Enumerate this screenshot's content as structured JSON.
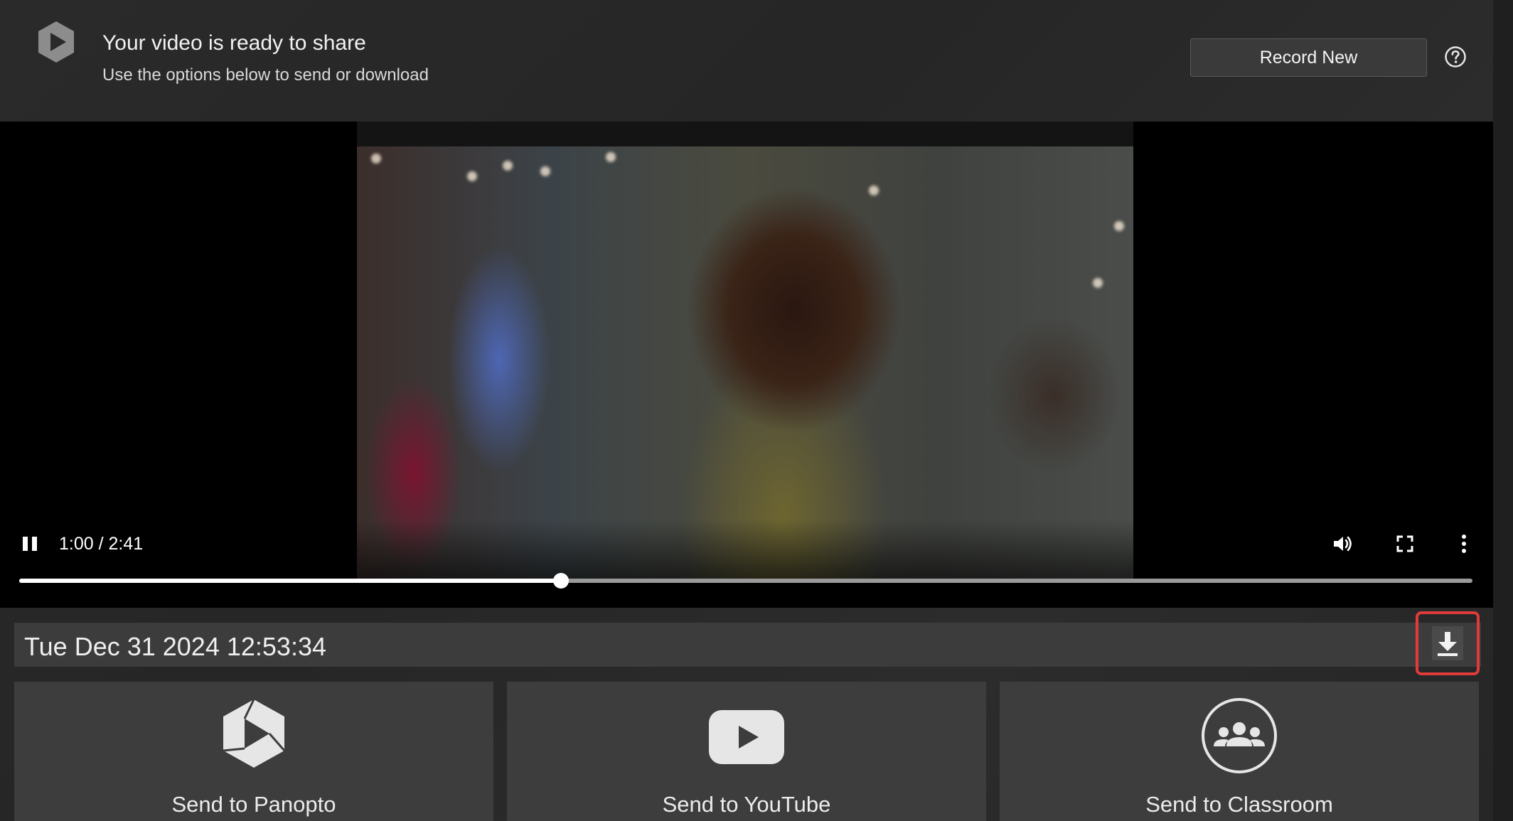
{
  "header": {
    "title": "Your video is ready to share",
    "subtitle": "Use the options below to send or download",
    "record_new_label": "Record New",
    "logo_icon": "panopto-logo-icon",
    "help_icon": "help-circle-icon"
  },
  "player": {
    "time_display": "1:00 / 2:41",
    "current_seconds": 60,
    "duration_seconds": 161,
    "pause_icon": "pause-icon",
    "volume_icon": "volume-icon",
    "fullscreen_icon": "fullscreen-icon",
    "more_icon": "more-vertical-icon"
  },
  "recording": {
    "name": "Tue Dec 31 2024 12:53:34",
    "download_icon": "download-icon",
    "download_highlight_color": "#e03b3b"
  },
  "share": {
    "panopto_label": "Send to Panopto",
    "youtube_label": "Send to YouTube",
    "classroom_label": "Send to Classroom"
  }
}
